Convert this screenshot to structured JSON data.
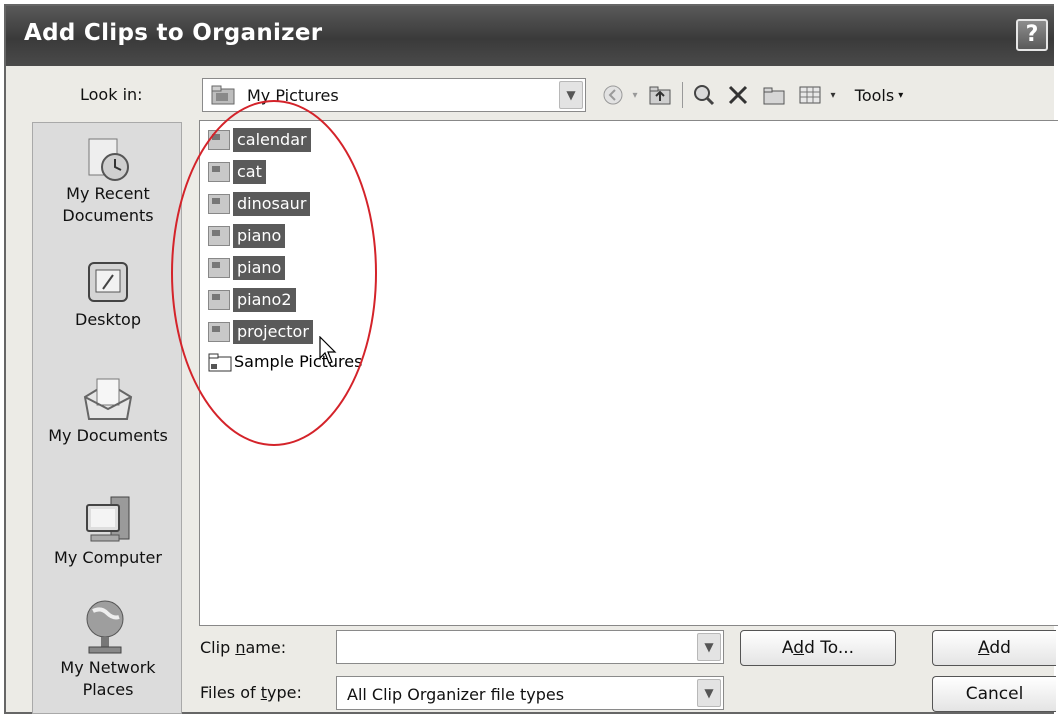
{
  "window": {
    "title": "Add Clips to Organizer",
    "help_label": "?"
  },
  "lookin": {
    "label": "Look in:",
    "value": "My Pictures"
  },
  "toolbar": {
    "tools_label": "Tools",
    "icons": [
      "back-icon",
      "up-folder-icon",
      "search-web-icon",
      "delete-icon",
      "new-folder-icon",
      "views-icon"
    ]
  },
  "places": [
    {
      "label": "My Recent\nDocuments",
      "icon": "recent-documents-icon"
    },
    {
      "label": "Desktop",
      "icon": "desktop-icon"
    },
    {
      "label": "My Documents",
      "icon": "my-documents-icon"
    },
    {
      "label": "My Computer",
      "icon": "my-computer-icon"
    },
    {
      "label": "My Network\nPlaces",
      "icon": "network-places-icon"
    }
  ],
  "files": [
    {
      "name": "calendar",
      "selected": true
    },
    {
      "name": "cat",
      "selected": true
    },
    {
      "name": "dinosaur",
      "selected": true
    },
    {
      "name": "piano",
      "selected": true
    },
    {
      "name": "piano",
      "selected": true
    },
    {
      "name": "piano2",
      "selected": true
    },
    {
      "name": "projector",
      "selected": true
    }
  ],
  "folders": [
    {
      "name": "Sample Pictures"
    }
  ],
  "clip_name": {
    "label_pre": "Clip ",
    "label_u": "n",
    "label_post": "ame:",
    "value": ""
  },
  "file_type": {
    "label_pre": "Files of ",
    "label_u": "t",
    "label_post": "ype:",
    "value": "All Clip Organizer file types"
  },
  "buttons": {
    "add_to_pre": "A",
    "add_to_u": "d",
    "add_to_post": "d To...",
    "add_pre": "",
    "add_u": "A",
    "add_post": "dd",
    "cancel": "Cancel"
  },
  "colors": {
    "annotation_ellipse": "#d4232a",
    "selection": "#5a5a5a"
  }
}
